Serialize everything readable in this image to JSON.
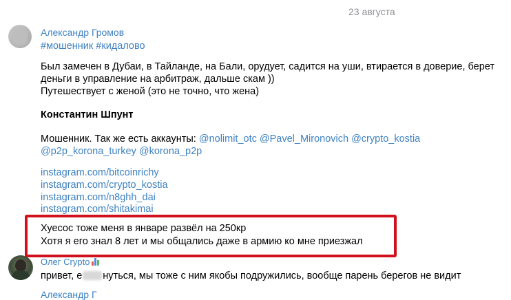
{
  "date_separator": "23 августа",
  "message_1": {
    "author": "Александр Громов",
    "hashtags": "#мошенник #кидалово",
    "text_line_1": "Был замечен в Дубаи, в Тайланде, на Бали, орудует, садится на уши, втирается в доверие, берет",
    "text_line_2": "деньги в управление на арбитраж, дальше скам ))",
    "text_line_3": "Путешествует с женой (это не точно, что жена)",
    "bold_name": "Константин Шпунт",
    "accounts_prefix": "Мошенник. Так же есть аккаунты: ",
    "accounts_line_1": "@nolimit_otc @Pavel_Mironovich @crypto_kostia",
    "accounts_line_2": "@p2p_korona_turkey @korona_p2p",
    "links": [
      "instagram.com/bitcoinrichy",
      "instagram.com/crypto_kostia",
      "instagram.com/n8ghh_dai",
      "instagram.com/shitakimai"
    ],
    "highlight_line_1": "Хуесос тоже меня в январе развёл на 250кр",
    "highlight_line_2": "Хотя я его знал 8 лет и мы общались даже в армию ко мне приезжал"
  },
  "message_2": {
    "author": "Олег Crypto",
    "author_icon": "bar-chart-emoji-icon",
    "text_before": "привет, е",
    "text_after": "нуться, мы тоже с ним якобы подружились, вообще парень берегов не видит"
  },
  "next_author_partial": "Александр Г",
  "colors": {
    "link": "#3e82c2",
    "highlight_border": "#d0101c",
    "date": "#8e8e93"
  }
}
